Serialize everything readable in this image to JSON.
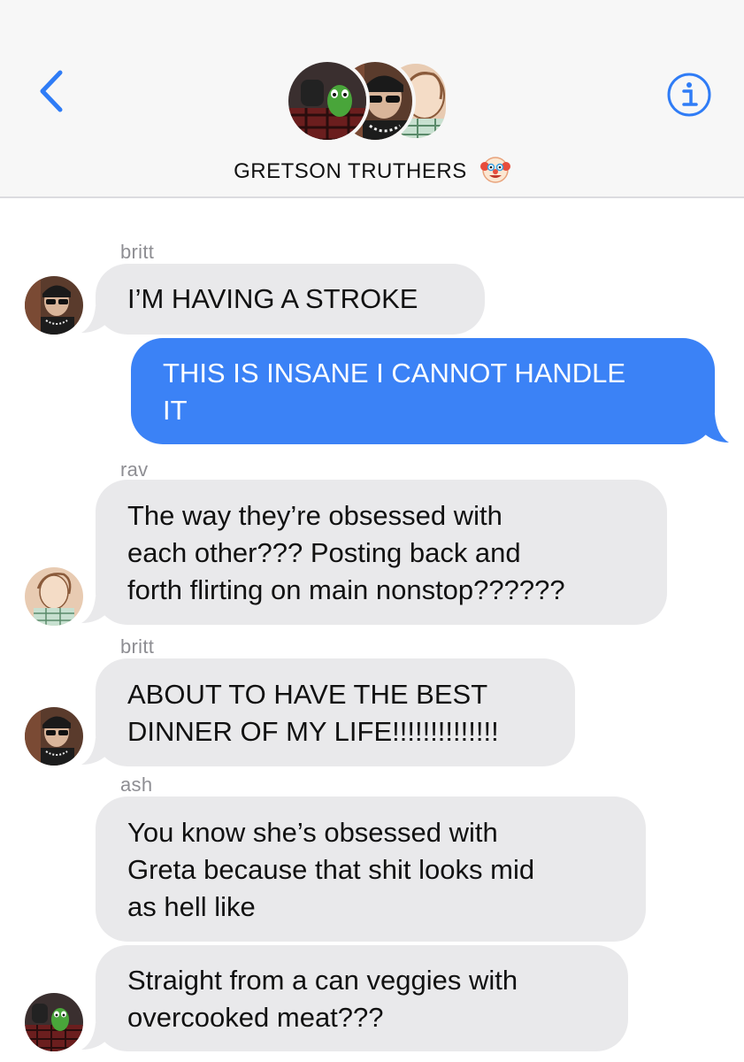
{
  "header": {
    "group_name": "GRETSON TRUTHERS",
    "back_icon": "chevron-left-icon",
    "info_icon": "info-icon",
    "title_emoji": "clown-face-emoji"
  },
  "colors": {
    "header_bg": "#f7f7f7",
    "incoming_bubble": "#e9e9eb",
    "outgoing_bubble": "#3b82f6",
    "accent_blue": "#2f7cf6",
    "sender_label": "#8e8e93"
  },
  "messages": [
    {
      "sender": "britt",
      "direction": "incoming",
      "text": "I’M HAVING A STROKE"
    },
    {
      "sender": "",
      "direction": "outgoing",
      "text_lines": [
        "THIS IS INSANE I CANNOT HANDLE",
        "IT"
      ]
    },
    {
      "sender": "rav",
      "direction": "incoming",
      "text_lines": [
        "The way they’re obsessed with",
        "each other??? Posting back and",
        "forth flirting on main nonstop??????"
      ]
    },
    {
      "sender": "britt",
      "direction": "incoming",
      "text_lines": [
        "ABOUT TO HAVE THE BEST",
        "DINNER OF MY LIFE!!!!!!!!!!!!!!"
      ]
    },
    {
      "sender": "ash",
      "direction": "incoming",
      "text_lines": [
        "You know she’s obsessed with",
        "Greta because that shit looks mid",
        "as hell like"
      ]
    },
    {
      "sender": "ash",
      "direction": "incoming",
      "text_lines": [
        "Straight from a can veggies with",
        "overcooked meat???"
      ]
    }
  ]
}
